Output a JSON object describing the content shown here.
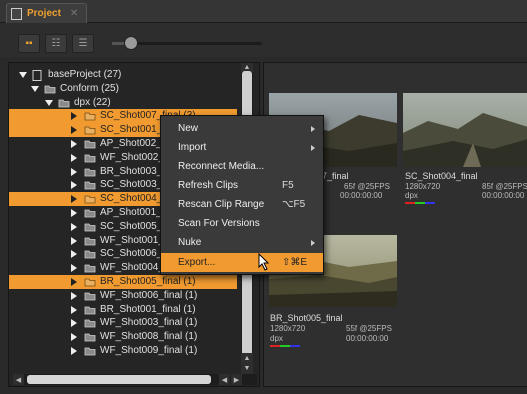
{
  "tab": {
    "title": "Project",
    "close": "✕"
  },
  "toolbar": {
    "view_buttons": [
      {
        "icon": "thumbnail-view-icon",
        "glyph": "▪▪"
      },
      {
        "icon": "list-view-icon",
        "glyph": "☷"
      },
      {
        "icon": "detail-view-icon",
        "glyph": "☰"
      }
    ],
    "thumbnail_size": 0.08
  },
  "tree": [
    {
      "label": "baseProject (27)",
      "depth": 0,
      "expanded": true,
      "icon": "project-icon",
      "selected": false
    },
    {
      "label": "Conform (25)",
      "depth": 1,
      "expanded": true,
      "icon": "folder-icon",
      "selected": false
    },
    {
      "label": "dpx (22)",
      "depth": 2,
      "expanded": true,
      "icon": "folder-icon",
      "selected": false
    },
    {
      "label": "SC_Shot007_final (3)",
      "depth": 3,
      "expanded": false,
      "icon": "clip-folder-icon",
      "selected": true
    },
    {
      "label": "SC_Shot001_final (2)",
      "depth": 3,
      "expanded": false,
      "icon": "clip-folder-icon",
      "selected": true
    },
    {
      "label": "AP_Shot002_final (1)",
      "depth": 3,
      "expanded": false,
      "icon": "clip-folder-icon",
      "selected": false
    },
    {
      "label": "WF_Shot002_final (1)",
      "depth": 3,
      "expanded": false,
      "icon": "clip-folder-icon",
      "selected": false
    },
    {
      "label": "BR_Shot003_final (1)",
      "depth": 3,
      "expanded": false,
      "icon": "clip-folder-icon",
      "selected": false
    },
    {
      "label": "SC_Shot003_final (1)",
      "depth": 3,
      "expanded": false,
      "icon": "clip-folder-icon",
      "selected": false
    },
    {
      "label": "SC_Shot004_final (1)",
      "depth": 3,
      "expanded": false,
      "icon": "clip-folder-icon",
      "selected": true
    },
    {
      "label": "AP_Shot001_final (1)",
      "depth": 3,
      "expanded": false,
      "icon": "clip-folder-icon",
      "selected": false
    },
    {
      "label": "SC_Shot005_final (1)",
      "depth": 3,
      "expanded": false,
      "icon": "clip-folder-icon",
      "selected": false
    },
    {
      "label": "WF_Shot001_final (1)",
      "depth": 3,
      "expanded": false,
      "icon": "clip-folder-icon",
      "selected": false
    },
    {
      "label": "SC_Shot006_final (1)",
      "depth": 3,
      "expanded": false,
      "icon": "clip-folder-icon",
      "selected": false
    },
    {
      "label": "WF_Shot004_final (1)",
      "depth": 3,
      "expanded": false,
      "icon": "clip-folder-icon",
      "selected": false
    },
    {
      "label": "BR_Shot005_final (1)",
      "depth": 3,
      "expanded": false,
      "icon": "clip-folder-icon",
      "selected": true
    },
    {
      "label": "WF_Shot006_final (1)",
      "depth": 3,
      "expanded": false,
      "icon": "clip-folder-icon",
      "selected": false
    },
    {
      "label": "BR_Shot001_final (1)",
      "depth": 3,
      "expanded": false,
      "icon": "clip-folder-icon",
      "selected": false
    },
    {
      "label": "WF_Shot003_final (1)",
      "depth": 3,
      "expanded": false,
      "icon": "clip-folder-icon",
      "selected": false
    },
    {
      "label": "WF_Shot008_final (1)",
      "depth": 3,
      "expanded": false,
      "icon": "clip-folder-icon",
      "selected": false
    },
    {
      "label": "WF_Shot009_final (1)",
      "depth": 3,
      "expanded": false,
      "icon": "clip-folder-icon",
      "selected": false
    }
  ],
  "clips": [
    {
      "name": "7_final",
      "res": "",
      "frames": "65f @25FPS",
      "tc": "00:00:00:00",
      "format": ""
    },
    {
      "name": "SC_Shot004_final",
      "res": "1280x720",
      "frames": "85f @25FPS",
      "tc": "00:00:00:00",
      "format": "dpx"
    },
    {
      "name": "BR_Shot005_final",
      "res": "1280x720",
      "frames": "55f @25FPS",
      "tc": "00:00:00:00",
      "format": "dpx"
    }
  ],
  "context_menu": {
    "items": [
      {
        "label": "New",
        "shortcut": "",
        "submenu": true,
        "highlighted": false
      },
      {
        "label": "Import",
        "shortcut": "",
        "submenu": true,
        "highlighted": false
      },
      {
        "label": "Reconnect Media...",
        "shortcut": "",
        "submenu": false,
        "highlighted": false
      },
      {
        "label": "Refresh Clips",
        "shortcut": "F5",
        "submenu": false,
        "highlighted": false
      },
      {
        "label": "Rescan Clip Range",
        "shortcut": "⌥F5",
        "submenu": false,
        "highlighted": false
      },
      {
        "label": "Scan For Versions",
        "shortcut": "",
        "submenu": false,
        "highlighted": false
      },
      {
        "label": "Nuke",
        "shortcut": "",
        "submenu": true,
        "highlighted": false
      },
      {
        "label": "Export...",
        "shortcut": "⇧⌘E",
        "submenu": false,
        "highlighted": true
      }
    ]
  },
  "colors": {
    "accent": "#f09a30",
    "background": "#2a2a2a",
    "panel": "#252525",
    "menu": "#3a3a3a"
  }
}
